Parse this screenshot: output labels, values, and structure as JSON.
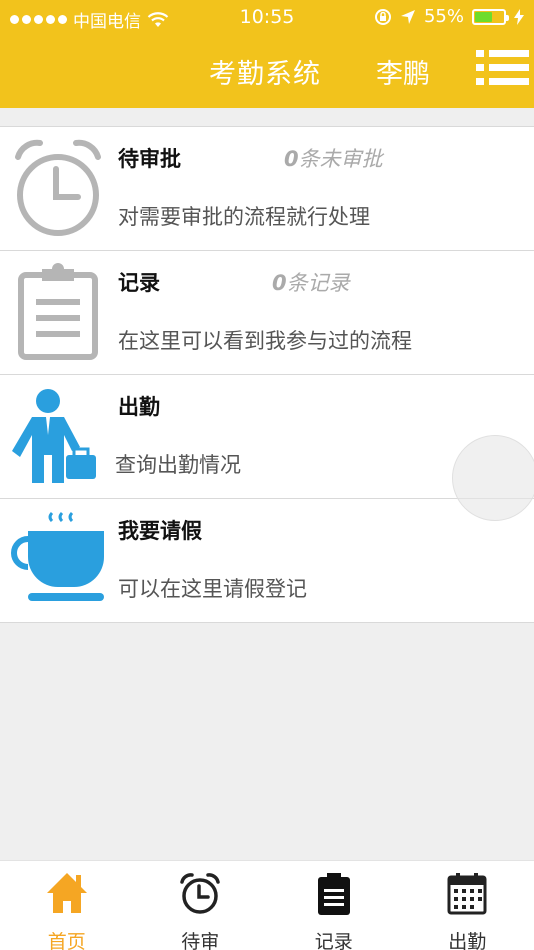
{
  "status_bar": {
    "carrier": "中国电信",
    "time": "10:55",
    "battery": "55%",
    "battery_level": 0.55
  },
  "header": {
    "title": "考勤系统",
    "user": "李鹏",
    "menu_icon": "hamburger-menu-icon"
  },
  "items": [
    {
      "title": "待审批",
      "count_num": "0",
      "count_text": "条未审批",
      "desc": "对需要审批的流程就行处理",
      "icon": "alarm-clock-icon"
    },
    {
      "title": "记录",
      "count_num": "0",
      "count_text": "条记录",
      "desc": "在这里可以看到我参与过的流程",
      "icon": "clipboard-icon"
    },
    {
      "title": "出勤",
      "count_num": "",
      "count_text": "",
      "desc": "查询出勤情况",
      "icon": "businessman-icon"
    },
    {
      "title": "我要请假",
      "count_num": "",
      "count_text": "",
      "desc": "可以在这里请假登记",
      "icon": "coffee-cup-icon"
    }
  ],
  "tabs": [
    {
      "label": "首页",
      "icon": "home-icon",
      "active": true
    },
    {
      "label": "待审",
      "icon": "alarm-clock-icon",
      "active": false
    },
    {
      "label": "记录",
      "icon": "clipboard-icon",
      "active": false
    },
    {
      "label": "出勤",
      "icon": "calendar-icon",
      "active": false
    }
  ],
  "colors": {
    "header": "#f2c31c",
    "icon_gray": "#b5b5b5",
    "icon_blue": "#2a9fde",
    "tab_active": "#f5a623"
  }
}
